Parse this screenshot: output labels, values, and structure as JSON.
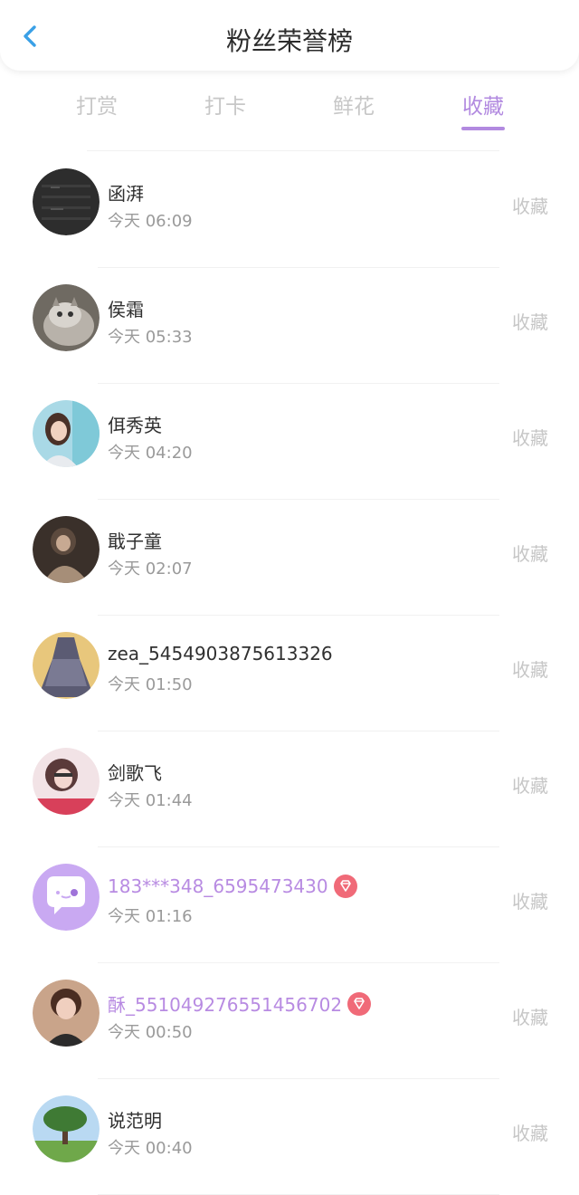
{
  "header": {
    "back_icon": "chevron-left-icon",
    "title": "粉丝荣誉榜"
  },
  "tabs": [
    {
      "label": "打赏"
    },
    {
      "label": "打卡"
    },
    {
      "label": "鲜花"
    },
    {
      "label": "收藏"
    }
  ],
  "active_tab_index": 3,
  "colors": {
    "accent": "#b28ae0",
    "vip_badge": "#f06a78",
    "muted_text": "#9a9a9a"
  },
  "fans": [
    {
      "name": "函湃",
      "time": "今天 06:09",
      "action": "收藏",
      "vip": false,
      "avatar": "dark-screen"
    },
    {
      "name": "侯霜",
      "time": "今天 05:33",
      "action": "收藏",
      "vip": false,
      "avatar": "cat"
    },
    {
      "name": "佴秀英",
      "time": "今天 04:20",
      "action": "收藏",
      "vip": false,
      "avatar": "girl-blue"
    },
    {
      "name": "戢子童",
      "time": "今天 02:07",
      "action": "收藏",
      "vip": false,
      "avatar": "girl-dark"
    },
    {
      "name": "zea_5454903875613326",
      "time": "今天 01:50",
      "action": "收藏",
      "vip": false,
      "avatar": "dress"
    },
    {
      "name": "剑歌飞",
      "time": "今天 01:44",
      "action": "收藏",
      "vip": false,
      "avatar": "girl-pink"
    },
    {
      "name": "183***348_6595473430",
      "time": "今天 01:16",
      "action": "收藏",
      "vip": true,
      "avatar": "chat-bubble"
    },
    {
      "name": "酥_551049276551456702",
      "time": "今天 00:50",
      "action": "收藏",
      "vip": true,
      "avatar": "child"
    },
    {
      "name": "说范明",
      "time": "今天 00:40",
      "action": "收藏",
      "vip": false,
      "avatar": "tree"
    }
  ]
}
